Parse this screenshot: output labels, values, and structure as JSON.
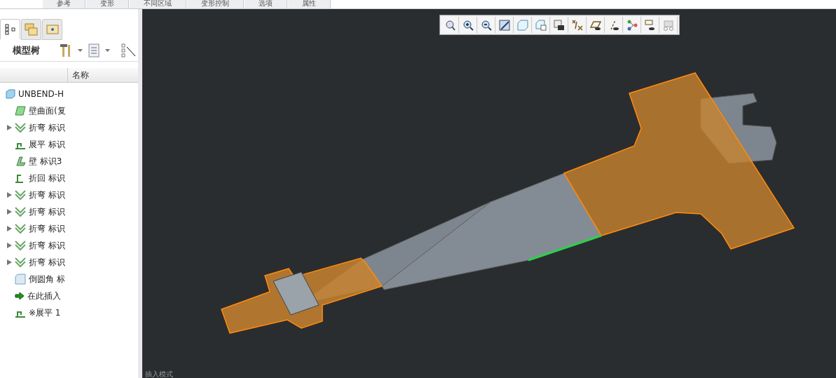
{
  "top_tabs": [
    {
      "label": "参考"
    },
    {
      "label": "变形"
    },
    {
      "label": "不同区域"
    },
    {
      "label": "变形控制"
    },
    {
      "label": "选项"
    },
    {
      "label": "属性"
    }
  ],
  "panel_tabs": [
    {
      "kind": "tree",
      "selected": true
    },
    {
      "kind": "folders",
      "selected": false
    },
    {
      "kind": "favorites",
      "selected": false
    }
  ],
  "model_tree": {
    "title": "模型树",
    "column": "名称",
    "items": [
      {
        "label": "UNBEND-H",
        "kind": "part"
      },
      {
        "label": "壁曲面(复",
        "kind": "wall",
        "expandable": false
      },
      {
        "label": "折弯 标识",
        "kind": "bend",
        "expandable": true
      },
      {
        "label": "展平 标识",
        "kind": "unbend",
        "expandable": false
      },
      {
        "label": "壁 标识3",
        "kind": "flange",
        "expandable": false
      },
      {
        "label": "折回 标识",
        "kind": "bendback",
        "expandable": false
      },
      {
        "label": "折弯 标识",
        "kind": "bend",
        "expandable": true
      },
      {
        "label": "折弯 标识",
        "kind": "bend",
        "expandable": true
      },
      {
        "label": "折弯 标识",
        "kind": "bend",
        "expandable": true
      },
      {
        "label": "折弯 标识",
        "kind": "bend",
        "expandable": true
      },
      {
        "label": "折弯 标识",
        "kind": "bend",
        "expandable": true
      },
      {
        "label": "倒圆角 标",
        "kind": "round",
        "expandable": false
      },
      {
        "label": "在此插入",
        "kind": "insert",
        "expandable": false
      },
      {
        "label": "※展平 1",
        "kind": "unbend",
        "expandable": false
      }
    ]
  },
  "status": "插入模式"
}
